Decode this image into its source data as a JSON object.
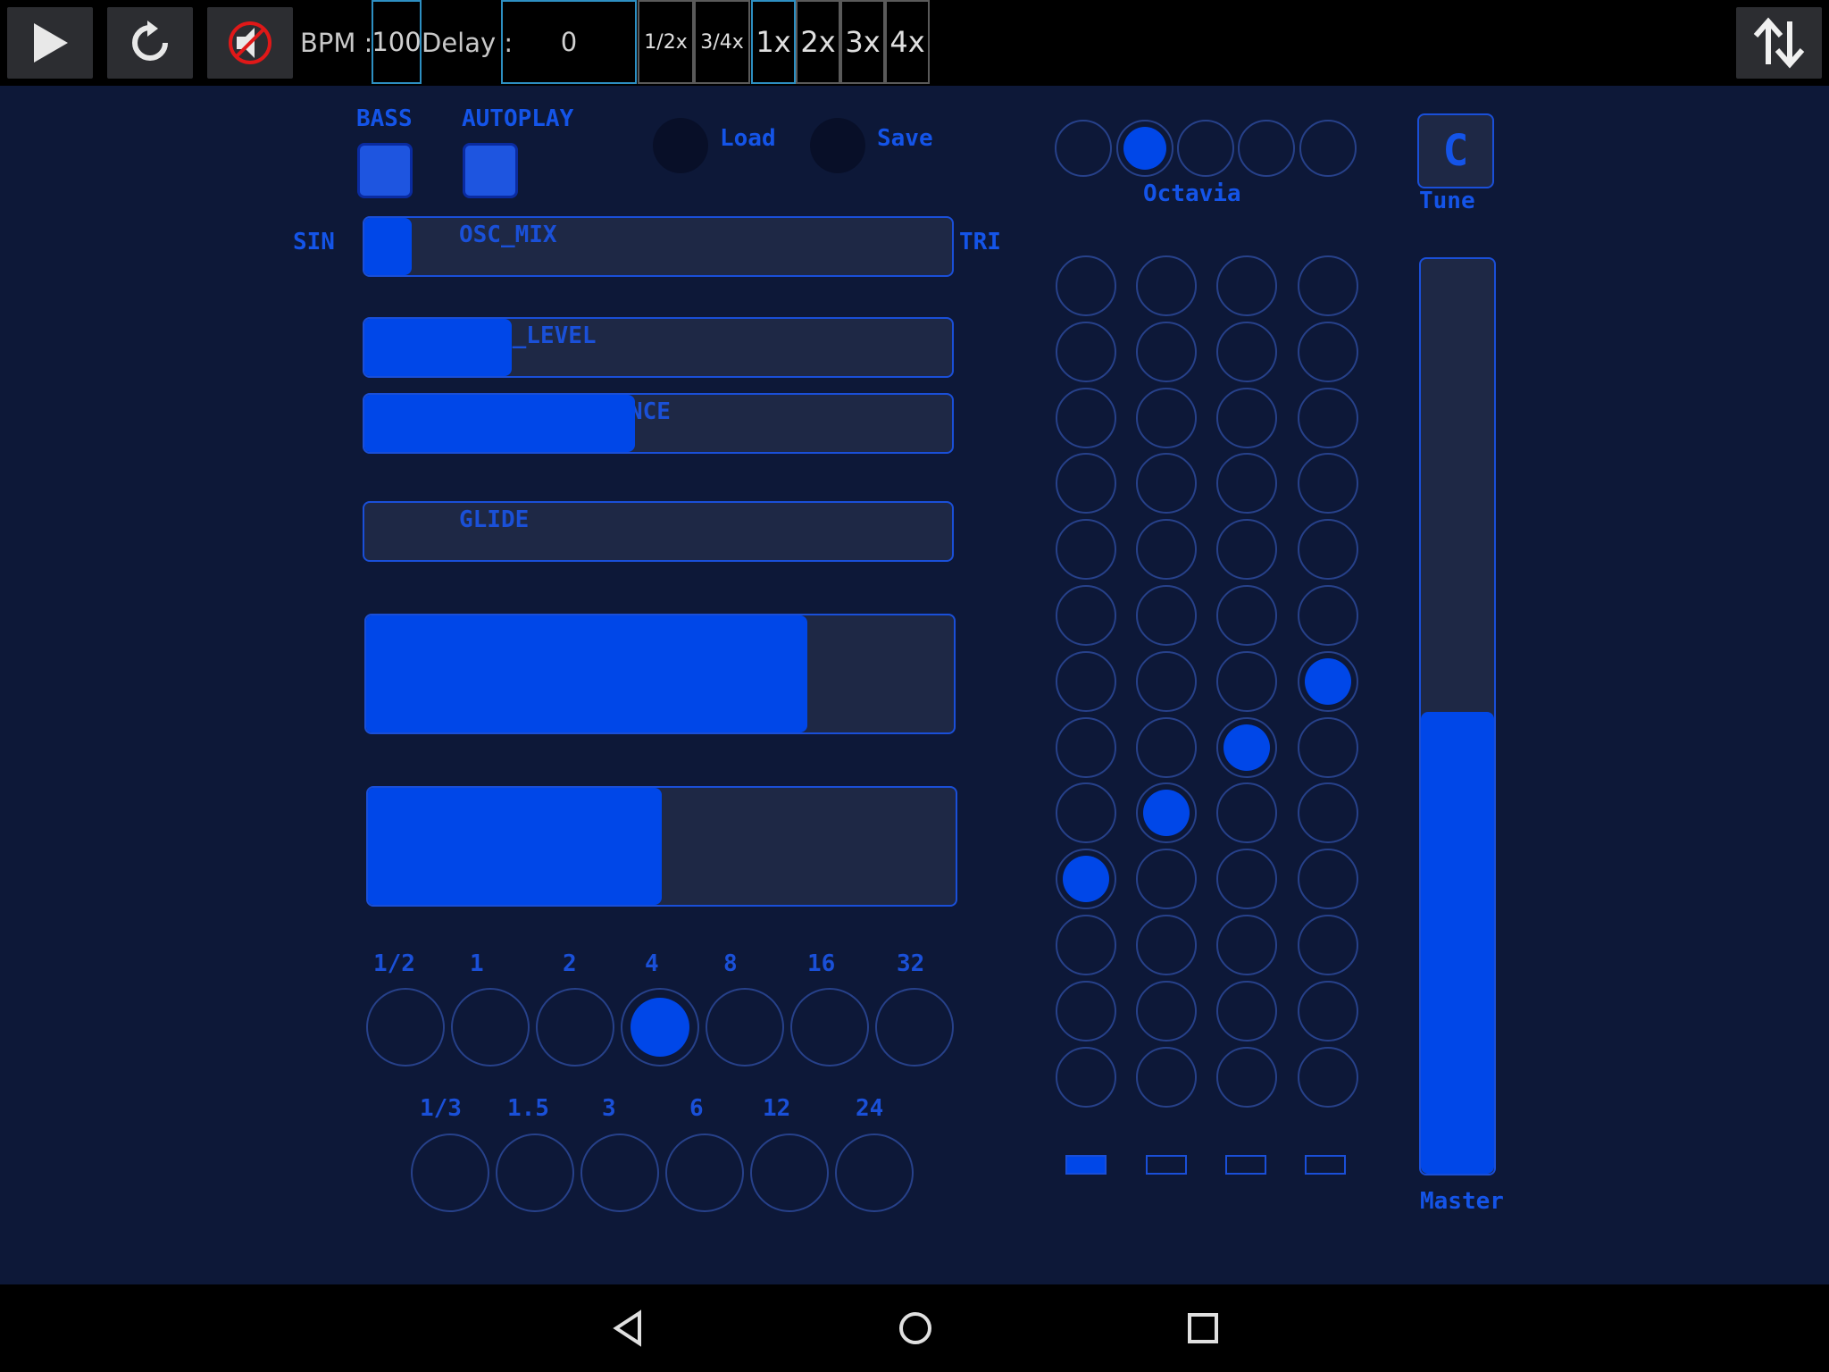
{
  "toolbar": {
    "bpm_label": "BPM :",
    "bpm_value": "100",
    "delay_label": "Delay :",
    "delay_value": "0",
    "speeds": [
      {
        "label": "1/2x",
        "active": false
      },
      {
        "label": "3/4x",
        "active": false
      },
      {
        "label": "1x",
        "active": true
      },
      {
        "label": "2x",
        "active": false
      },
      {
        "label": "3x",
        "active": false
      },
      {
        "label": "4x",
        "active": false
      }
    ],
    "icons": {
      "play": "play-icon",
      "reload": "reload-icon",
      "mute": "mute-icon",
      "swap": "swap-vertical-icon"
    }
  },
  "controls": {
    "bass_label": "BASS",
    "autoplay_label": "AUTOPLAY",
    "bass_checked": true,
    "autoplay_checked": true,
    "load_label": "Load",
    "save_label": "Save"
  },
  "sliders": {
    "sin_label": "SIN",
    "tri_label": "TRI",
    "osc_mix": {
      "label": "OSC_MIX",
      "value": 0.08
    },
    "noise_level": {
      "label": "E_LEVEL",
      "value": 0.25
    },
    "resonance": {
      "label": "NCE",
      "value": 0.46
    },
    "glide": {
      "label": "GLIDE",
      "value": 0.0
    },
    "big1": {
      "value": 0.75
    },
    "big2": {
      "value": 0.5
    }
  },
  "rates_top": {
    "labels": [
      "1/2",
      "1",
      "2",
      "4",
      "8",
      "16",
      "32"
    ],
    "selected": 3
  },
  "rates_bottom": {
    "labels": [
      "1/3",
      "1.5",
      "3",
      "6",
      "12",
      "24"
    ],
    "selected": -1
  },
  "octave": {
    "label": "Octavia",
    "count": 5,
    "selected": 1
  },
  "tune": {
    "value": "C",
    "label": "Tune"
  },
  "grid": {
    "rows": 13,
    "cols": 4,
    "active": [
      [
        6,
        3
      ],
      [
        7,
        2
      ],
      [
        8,
        1
      ],
      [
        9,
        0
      ]
    ],
    "pages": 4,
    "page_selected": 0
  },
  "master": {
    "label": "Master",
    "value": 0.505
  },
  "colors": {
    "accent": "#0047e8",
    "background": "#0d1838",
    "toolbar": "#000000"
  }
}
